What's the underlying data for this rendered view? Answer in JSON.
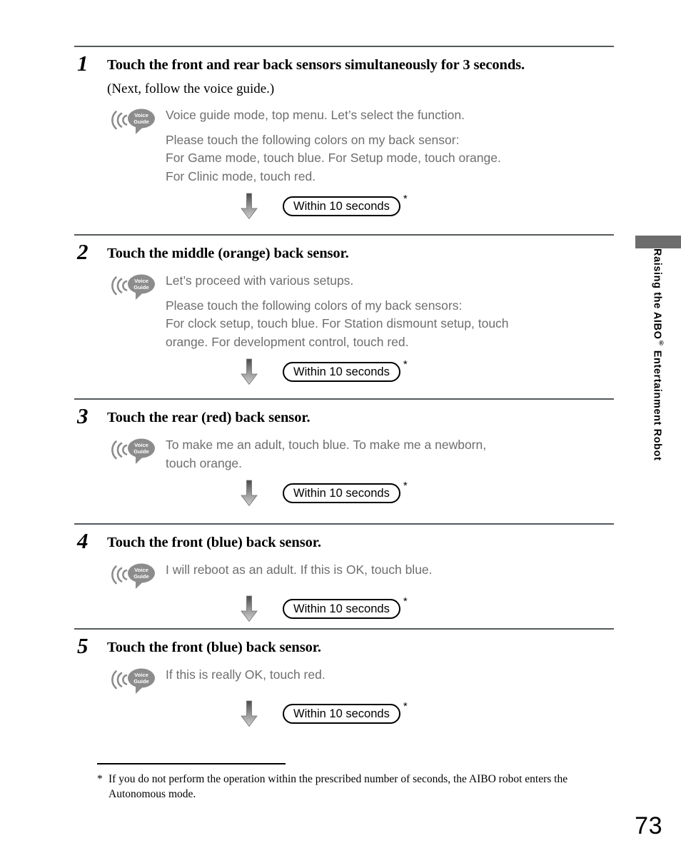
{
  "page": {
    "number": "73",
    "side_tab_label": "Raising the AIBO",
    "side_tab_label_sup": "®",
    "side_tab_label_rest": " Entertainment Robot",
    "accent_gray": "#6d6d6d",
    "voice_text_gray": "#6e6e6e"
  },
  "steps": [
    {
      "number": "1",
      "title": "Touch the front and rear back sensors simultaneously for 3 seconds.",
      "subtitle": "(Next, follow the voice guide.)",
      "icon_label_top": "Voice",
      "icon_label_bottom": "Guide",
      "voice_first": "Voice guide mode, top menu. Let’s select the function.",
      "voice_rest": [
        "Please touch the following colors on my back sensor:",
        "For Game mode, touch blue. For Setup mode, touch orange.",
        "For Clinic mode, touch red."
      ],
      "timer_label": "Within 10 seconds",
      "timer_star": "*"
    },
    {
      "number": "2",
      "title": "Touch the middle (orange) back sensor.",
      "subtitle": "",
      "icon_label_top": "Voice",
      "icon_label_bottom": "Guide",
      "voice_first": "Let’s proceed with various setups.",
      "voice_rest": [
        "Please touch the following colors of my back sensors:",
        "For clock setup, touch blue. For Station dismount setup, touch",
        "orange. For development control, touch red."
      ],
      "timer_label": "Within 10 seconds",
      "timer_star": "*"
    },
    {
      "number": "3",
      "title": "Touch the rear (red) back sensor.",
      "subtitle": "",
      "icon_label_top": "Voice",
      "icon_label_bottom": "Guide",
      "voice_first": "To make me an adult, touch blue. To make me a newborn,",
      "voice_rest": [
        "touch orange."
      ],
      "voice_rest_tight": true,
      "timer_label": "Within 10 seconds",
      "timer_star": "*"
    },
    {
      "number": "4",
      "title": "Touch the front (blue) back sensor.",
      "subtitle": "",
      "icon_label_top": "Voice",
      "icon_label_bottom": "Guide",
      "voice_first": "I will reboot as an adult. If this is OK, touch blue.",
      "voice_rest": [],
      "timer_label": "Within 10 seconds",
      "timer_star": "*"
    },
    {
      "number": "5",
      "title": "Touch the front (blue) back sensor.",
      "subtitle": "",
      "icon_label_top": "Voice",
      "icon_label_bottom": "Guide",
      "voice_first": "If this is really OK, touch red.",
      "voice_rest": [],
      "timer_label": "Within 10 seconds",
      "timer_star": "*"
    }
  ],
  "footnote": {
    "mark": "*",
    "text": "If you do not perform the operation within the prescribed number of seconds, the AIBO robot enters the Autonomous mode."
  }
}
